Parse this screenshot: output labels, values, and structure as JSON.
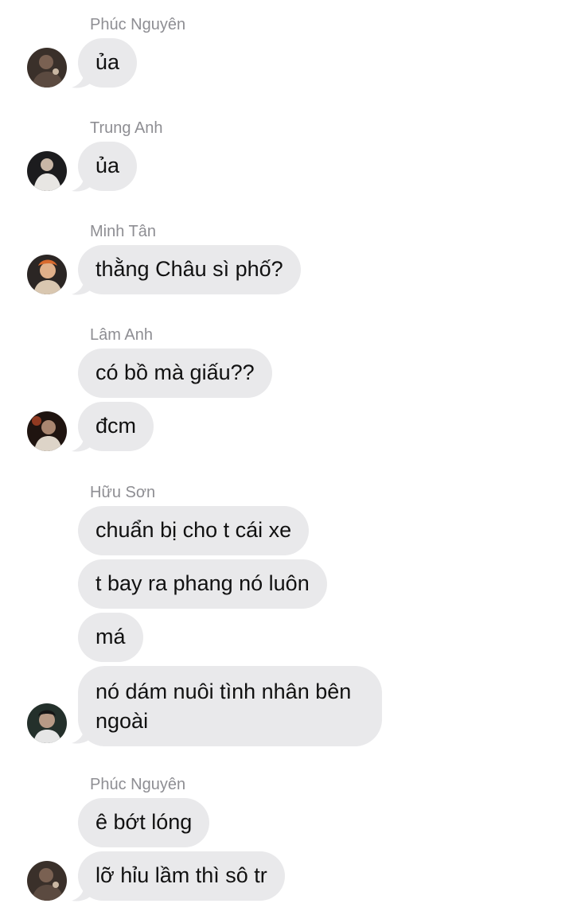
{
  "groups": [
    {
      "sender": "Phúc Nguyên",
      "avatar_icon": "user-avatar-icon",
      "messages": [
        "ủa"
      ]
    },
    {
      "sender": "Trung Anh",
      "avatar_icon": "user-avatar-icon",
      "messages": [
        "ủa"
      ]
    },
    {
      "sender": "Minh Tân",
      "avatar_icon": "user-avatar-icon",
      "messages": [
        "thằng Châu sì phố?"
      ]
    },
    {
      "sender": "Lâm Anh",
      "avatar_icon": "user-avatar-icon",
      "messages": [
        "có bồ mà giấu??",
        "đcm"
      ]
    },
    {
      "sender": "Hữu Sơn",
      "avatar_icon": "user-avatar-icon",
      "messages": [
        "chuẩn bị cho t cái xe",
        "t bay ra phang nó luôn",
        "má",
        "nó dám nuôi tình nhân bên ngoài"
      ]
    },
    {
      "sender": "Phúc Nguyên",
      "avatar_icon": "user-avatar-icon",
      "messages": [
        "ê bớt lóng",
        "lỡ hỉu lầm thì sô tr"
      ]
    }
  ],
  "colors": {
    "bubble": "#e9e9eb",
    "sender_name": "#8e8e93",
    "message_text": "#111111",
    "background": "#ffffff"
  }
}
